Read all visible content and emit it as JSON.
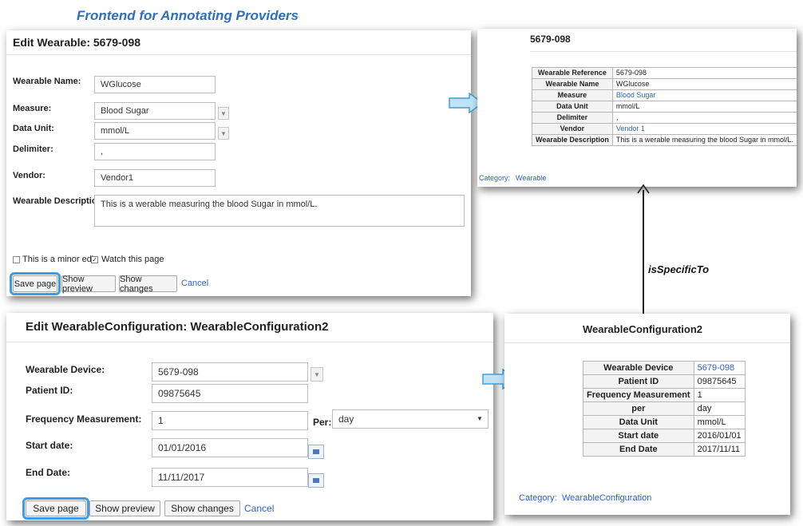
{
  "heading": "Frontend for Annotating Providers",
  "wearable_form": {
    "title": "Edit Wearable: 5679-098",
    "fields": {
      "name_label": "Wearable Name:",
      "name_value": "WGlucose",
      "measure_label": "Measure:",
      "measure_value": "Blood Sugar",
      "unit_label": "Data Unit:",
      "unit_value": "mmol/L",
      "delimiter_label": "Delimiter:",
      "delimiter_value": ",",
      "vendor_label": "Vendor:",
      "vendor_value": "Vendor1",
      "description_label": "Wearable Description:",
      "description_value": "This is a werable measuring the blood Sugar in mmol/L."
    },
    "minor_edit_label": "This is a minor edit",
    "watch_label": "Watch this page",
    "save_label": "Save page",
    "preview_label": "Show preview",
    "changes_label": "Show changes",
    "cancel_label": "Cancel"
  },
  "wearable_view": {
    "title": "5679-098",
    "rows": [
      {
        "key": "Wearable Reference",
        "value": "5679-098"
      },
      {
        "key": "Wearable Name",
        "value": "WGlucose"
      },
      {
        "key": "Measure",
        "value": "Blood Sugar"
      },
      {
        "key": "Data Unit",
        "value": "mmol/L"
      },
      {
        "key": "Delimiter",
        "value": ","
      },
      {
        "key": "Vendor",
        "value": "Vendor 1"
      },
      {
        "key": "Wearable Description",
        "value": "This is a werable measuring the blood Sugar in mmol/L."
      }
    ],
    "category_label": "Category:",
    "category_value": "Wearable"
  },
  "relation_label": "isSpecificTo",
  "config_form": {
    "title": "Edit WearableConfiguration: WearableConfiguration2",
    "fields": {
      "device_label": "Wearable Device:",
      "device_value": "5679-098",
      "patient_label": "Patient ID:",
      "patient_value": "09875645",
      "freq_label": "Frequency Measurement:",
      "freq_value": "1",
      "per_label": "Per:",
      "per_value": "day",
      "start_label": "Start date:",
      "start_value": "01/01/2016",
      "end_label": "End Date:",
      "end_value": "11/11/2017"
    },
    "save_label": "Save page",
    "preview_label": "Show preview",
    "changes_label": "Show changes",
    "cancel_label": "Cancel"
  },
  "config_view": {
    "title": "WearableConfiguration2",
    "rows": [
      {
        "key": "Wearable Device",
        "value": "5679-098"
      },
      {
        "key": "Patient ID",
        "value": "09875645"
      },
      {
        "key": "Frequency Measurement",
        "value": "1"
      },
      {
        "key": "per",
        "value": "day"
      },
      {
        "key": "Data Unit",
        "value": "mmol/L"
      },
      {
        "key": "Start date",
        "value": "2016/01/01"
      },
      {
        "key": "End Date",
        "value": "2017/11/11"
      }
    ],
    "category_label": "Category:",
    "category_value": "WearableConfiguration"
  },
  "colors": {
    "accent": "#3d9be9",
    "link": "#2a63c9",
    "heading": "#2f6fc0",
    "arrow_fill": "#bfe3f5"
  }
}
